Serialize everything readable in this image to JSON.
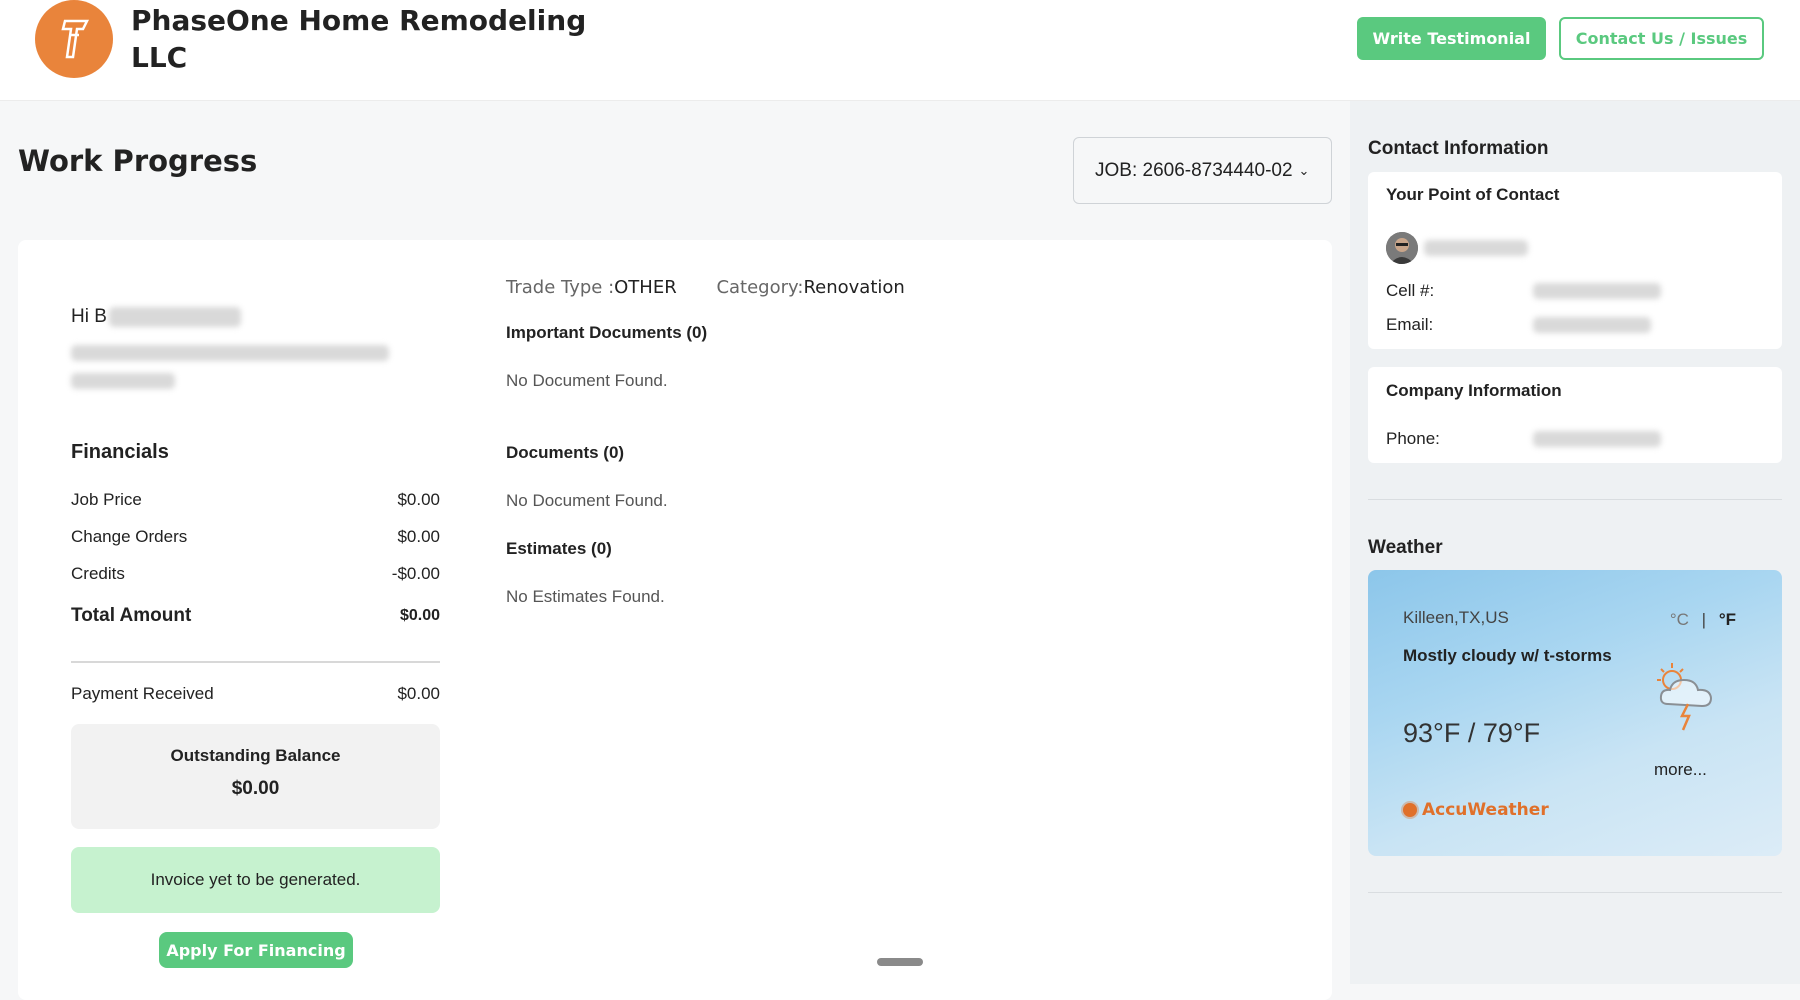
{
  "header": {
    "company_name": "PhaseOne Home Remodeling LLC",
    "write_testimonial": "Write Testimonial",
    "contact_us": "Contact Us / Issues"
  },
  "main": {
    "page_title": "Work Progress",
    "job_select": "JOB: 2606-8734440-02",
    "greeting_prefix": "Hi B",
    "trade_type_label": "Trade Type :",
    "trade_type_value": "OTHER",
    "category_label": "Category:",
    "category_value": "Renovation",
    "important_documents_title": "Important Documents (0)",
    "important_documents_empty": "No Document Found.",
    "documents_title": "Documents (0)",
    "documents_empty": "No Document Found.",
    "estimates_title": "Estimates (0)",
    "estimates_empty": "No Estimates Found."
  },
  "financials": {
    "title": "Financials",
    "rows": [
      {
        "label": "Job Price",
        "value": "$0.00"
      },
      {
        "label": "Change Orders",
        "value": "$0.00"
      },
      {
        "label": "Credits",
        "value": "-$0.00"
      }
    ],
    "total_label": "Total Amount",
    "total_value": "$0.00",
    "payment_label": "Payment Received",
    "payment_value": "$0.00",
    "outstanding_label": "Outstanding Balance",
    "outstanding_value": "$0.00",
    "invoice_status": "Invoice yet to be generated.",
    "apply_financing": "Apply For Financing"
  },
  "sidebar": {
    "contact_heading": "Contact Information",
    "point_of_contact_title": "Your Point of Contact",
    "cell_label": "Cell #:",
    "email_label": "Email:",
    "company_title": "Company Information",
    "phone_label": "Phone:",
    "weather_heading": "Weather"
  },
  "weather": {
    "location": "Killeen,TX,US",
    "unit_c": "°C",
    "unit_sep": "|",
    "unit_f": "°F",
    "description": "Mostly cloudy w/ t-storms",
    "temperature": "93°F / 79°F",
    "more": "more...",
    "brand": "AccuWeather",
    "icon": "thunderstorm-cloud-sun-icon"
  },
  "colors": {
    "accent_green": "#5ac97f",
    "logo_orange": "#e9843b",
    "invoice_bg": "#c6f2cf"
  }
}
